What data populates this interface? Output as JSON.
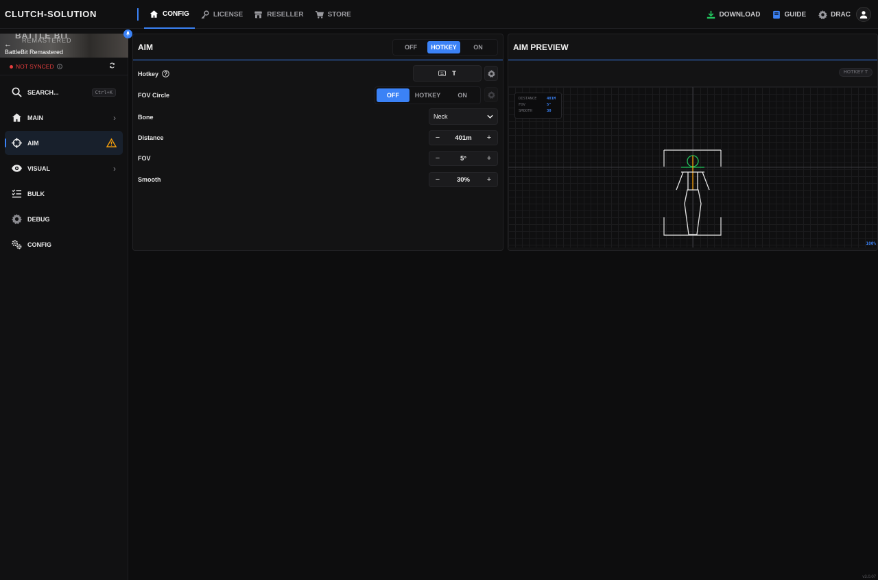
{
  "app": {
    "brand": "CLUTCH-SOLUTION",
    "version": "v3.0.07"
  },
  "topnav": {
    "tabs": [
      {
        "label": "CONFIG",
        "icon": "home-icon",
        "active": true
      },
      {
        "label": "LICENSE",
        "icon": "key-icon",
        "active": false
      },
      {
        "label": "RESELLER",
        "icon": "store-icon",
        "active": false
      },
      {
        "label": "STORE",
        "icon": "cart-icon",
        "active": false
      }
    ],
    "right": {
      "download": "DOWNLOAD",
      "guide": "GUIDE",
      "user": "DRAC"
    }
  },
  "sidebar": {
    "game": {
      "logo": "BATTLE BIT",
      "logo_sub": "REMASTERED",
      "title": "BattleBit Remastered"
    },
    "sync_status": "NOT SYNCED",
    "search": {
      "label": "SEARCH...",
      "shortcut": "Ctrl+K"
    },
    "items": [
      {
        "label": "MAIN",
        "icon": "home-icon"
      },
      {
        "label": "AIM",
        "icon": "crosshair-icon"
      },
      {
        "label": "VISUAL",
        "icon": "eye-icon"
      },
      {
        "label": "BULK",
        "icon": "checklist-icon"
      },
      {
        "label": "DEBUG",
        "icon": "gear-icon"
      },
      {
        "label": "CONFIG",
        "icon": "gears-icon"
      }
    ]
  },
  "aim_panel": {
    "title": "AIM",
    "mode": {
      "options": [
        "OFF",
        "HOTKEY",
        "ON"
      ],
      "selected": "HOTKEY"
    },
    "hotkey": {
      "label": "Hotkey",
      "value": "T"
    },
    "fov_circle": {
      "label": "FOV Circle",
      "options": [
        "OFF",
        "HOTKEY",
        "ON"
      ],
      "selected": "OFF"
    },
    "bone": {
      "label": "Bone",
      "value": "Neck"
    },
    "distance": {
      "label": "Distance",
      "value": "401m"
    },
    "fov": {
      "label": "FOV",
      "value": "5°"
    },
    "smooth": {
      "label": "Smooth",
      "value": "30%"
    }
  },
  "preview_panel": {
    "title": "AIM PREVIEW",
    "hotkey_badge": "HOTKEY T",
    "readout": [
      {
        "key": "DISTANCE",
        "value": "401M"
      },
      {
        "key": "FOV",
        "value": "5°"
      },
      {
        "key": "SMOOTH",
        "value": "30"
      }
    ],
    "zoom": "100%",
    "colors": {
      "head": "#22c55e",
      "neck_line": "#22c55e",
      "spine": "#f59e0b",
      "body": "#e6e6e6"
    }
  },
  "colors": {
    "accent": "#3b82f6",
    "warning": "#f59e0b",
    "error": "#e53e3e",
    "download": "#22c55e"
  }
}
